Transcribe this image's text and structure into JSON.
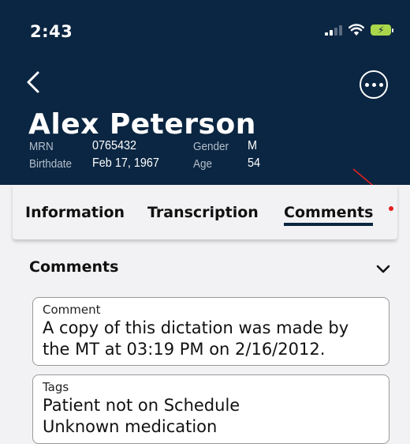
{
  "status_bar": {
    "time": "2:43",
    "icons": [
      "signal-icon",
      "wifi-icon",
      "battery-charging-icon"
    ]
  },
  "header": {
    "back_icon": "chevron-left-icon",
    "more_icon": "more-circle-icon",
    "patient_name": "Alex Peterson",
    "mrn_label": "MRN",
    "mrn_value": "0765432",
    "gender_label": "Gender",
    "gender_value": "M",
    "birthdate_label": "Birthdate",
    "birthdate_value": "Feb 17, 1967",
    "age_label": "Age",
    "age_value": "54"
  },
  "tabs": [
    {
      "label": "Information",
      "active": false
    },
    {
      "label": "Transcription",
      "active": false
    },
    {
      "label": "Comments",
      "active": true,
      "has_notification": true
    }
  ],
  "section": {
    "title": "Comments",
    "toggle_icon": "chevron-down-icon"
  },
  "fields": {
    "comment": {
      "label": "Comment",
      "value": "A copy of this dictation was made by\nthe MT at 03:19 PM on 2/16/2012."
    },
    "tags": {
      "label": "Tags",
      "value": "Patient not on Schedule\nUnknown medication"
    }
  },
  "colors": {
    "header_bg": "#0b2642",
    "page_bg": "#f2f2f4",
    "notification": "#e32020",
    "annotation_arrow": "#e32020"
  }
}
